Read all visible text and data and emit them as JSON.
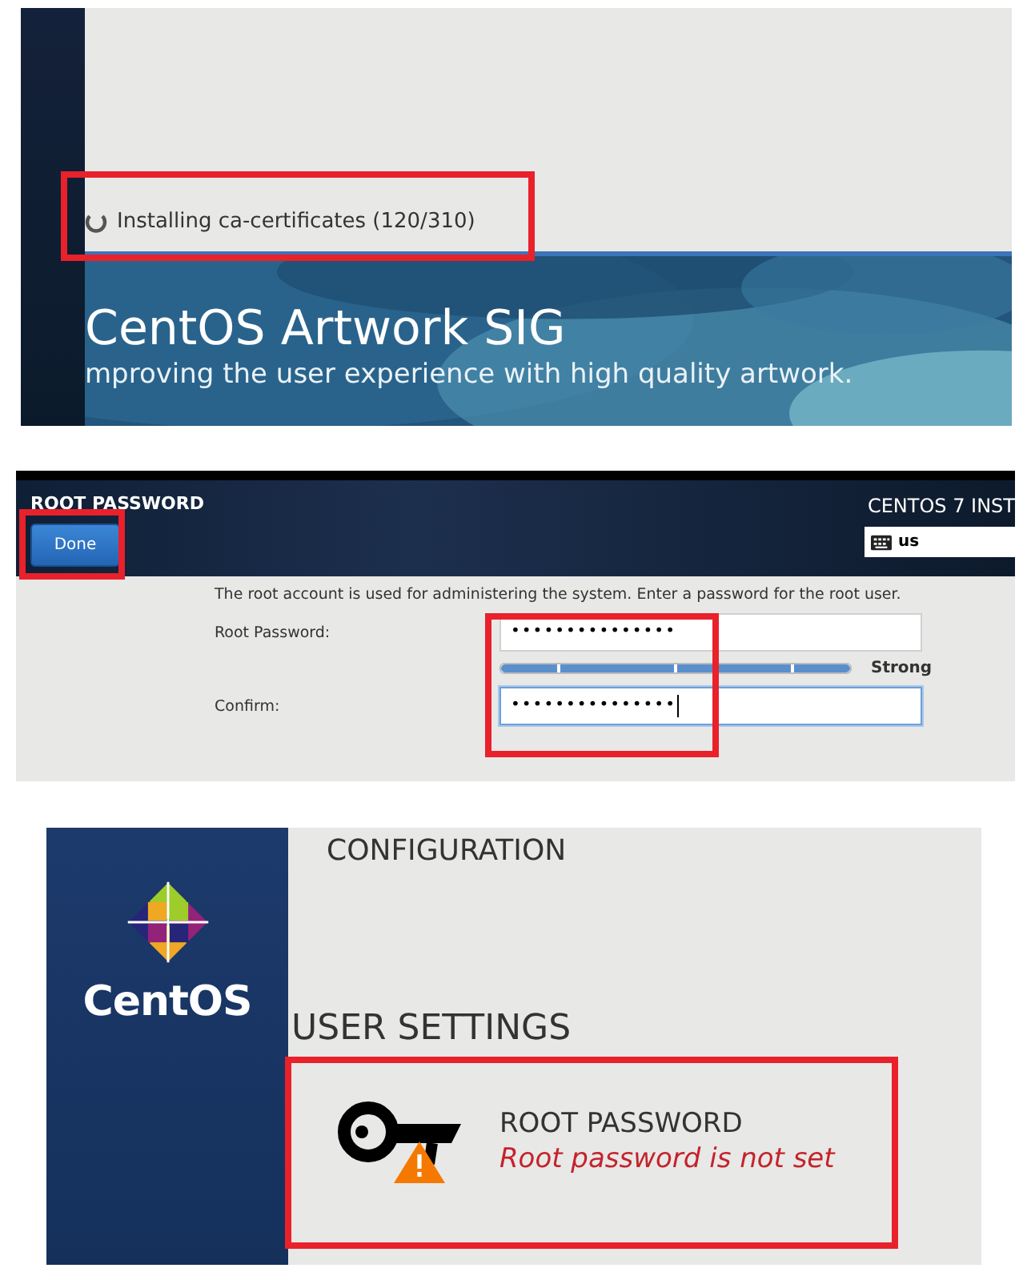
{
  "install_progress": {
    "status": "Installing ca-certificates (120/310)",
    "banner": {
      "title": "CentOS Artwork SIG",
      "subtitle": "mproving the user experience with high quality artwork."
    }
  },
  "root_password_screen": {
    "title": "ROOT PASSWORD",
    "done_button": "Done",
    "product": "CENTOS 7 INST",
    "keyboard_layout": "us",
    "description": "The root account is used for administering the system.  Enter a password for the root user.",
    "fields": [
      {
        "label": "Root Password:",
        "value": "•••••••••••••••",
        "focused": false
      },
      {
        "label": "Confirm:",
        "value": "•••••••••••••••",
        "focused": true
      }
    ],
    "strength": {
      "level": 1,
      "label": "Strong"
    }
  },
  "summary_screen": {
    "logo_text": "CentOS",
    "section": "CONFIGURATION",
    "category": "USER SETTINGS",
    "spoke": {
      "title": "ROOT PASSWORD",
      "status": "Root password is not set",
      "warning": true
    }
  }
}
